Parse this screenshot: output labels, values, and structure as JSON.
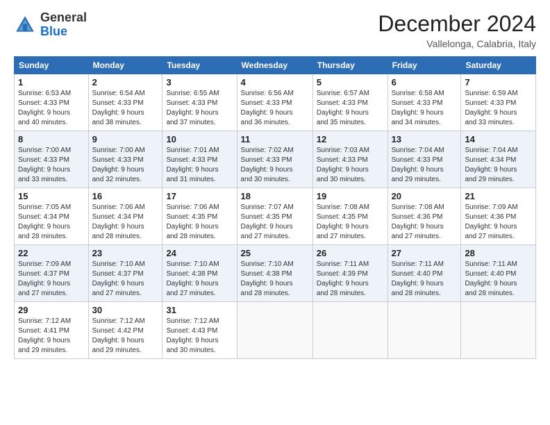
{
  "header": {
    "logo": {
      "general": "General",
      "blue": "Blue"
    },
    "month_title": "December 2024",
    "location": "Vallelonga, Calabria, Italy"
  },
  "calendar": {
    "weekdays": [
      "Sunday",
      "Monday",
      "Tuesday",
      "Wednesday",
      "Thursday",
      "Friday",
      "Saturday"
    ],
    "weeks": [
      [
        {
          "day": "1",
          "info": "Sunrise: 6:53 AM\nSunset: 4:33 PM\nDaylight: 9 hours\nand 40 minutes."
        },
        {
          "day": "2",
          "info": "Sunrise: 6:54 AM\nSunset: 4:33 PM\nDaylight: 9 hours\nand 38 minutes."
        },
        {
          "day": "3",
          "info": "Sunrise: 6:55 AM\nSunset: 4:33 PM\nDaylight: 9 hours\nand 37 minutes."
        },
        {
          "day": "4",
          "info": "Sunrise: 6:56 AM\nSunset: 4:33 PM\nDaylight: 9 hours\nand 36 minutes."
        },
        {
          "day": "5",
          "info": "Sunrise: 6:57 AM\nSunset: 4:33 PM\nDaylight: 9 hours\nand 35 minutes."
        },
        {
          "day": "6",
          "info": "Sunrise: 6:58 AM\nSunset: 4:33 PM\nDaylight: 9 hours\nand 34 minutes."
        },
        {
          "day": "7",
          "info": "Sunrise: 6:59 AM\nSunset: 4:33 PM\nDaylight: 9 hours\nand 33 minutes."
        }
      ],
      [
        {
          "day": "8",
          "info": "Sunrise: 7:00 AM\nSunset: 4:33 PM\nDaylight: 9 hours\nand 33 minutes."
        },
        {
          "day": "9",
          "info": "Sunrise: 7:00 AM\nSunset: 4:33 PM\nDaylight: 9 hours\nand 32 minutes."
        },
        {
          "day": "10",
          "info": "Sunrise: 7:01 AM\nSunset: 4:33 PM\nDaylight: 9 hours\nand 31 minutes."
        },
        {
          "day": "11",
          "info": "Sunrise: 7:02 AM\nSunset: 4:33 PM\nDaylight: 9 hours\nand 30 minutes."
        },
        {
          "day": "12",
          "info": "Sunrise: 7:03 AM\nSunset: 4:33 PM\nDaylight: 9 hours\nand 30 minutes."
        },
        {
          "day": "13",
          "info": "Sunrise: 7:04 AM\nSunset: 4:33 PM\nDaylight: 9 hours\nand 29 minutes."
        },
        {
          "day": "14",
          "info": "Sunrise: 7:04 AM\nSunset: 4:34 PM\nDaylight: 9 hours\nand 29 minutes."
        }
      ],
      [
        {
          "day": "15",
          "info": "Sunrise: 7:05 AM\nSunset: 4:34 PM\nDaylight: 9 hours\nand 28 minutes."
        },
        {
          "day": "16",
          "info": "Sunrise: 7:06 AM\nSunset: 4:34 PM\nDaylight: 9 hours\nand 28 minutes."
        },
        {
          "day": "17",
          "info": "Sunrise: 7:06 AM\nSunset: 4:35 PM\nDaylight: 9 hours\nand 28 minutes."
        },
        {
          "day": "18",
          "info": "Sunrise: 7:07 AM\nSunset: 4:35 PM\nDaylight: 9 hours\nand 27 minutes."
        },
        {
          "day": "19",
          "info": "Sunrise: 7:08 AM\nSunset: 4:35 PM\nDaylight: 9 hours\nand 27 minutes."
        },
        {
          "day": "20",
          "info": "Sunrise: 7:08 AM\nSunset: 4:36 PM\nDaylight: 9 hours\nand 27 minutes."
        },
        {
          "day": "21",
          "info": "Sunrise: 7:09 AM\nSunset: 4:36 PM\nDaylight: 9 hours\nand 27 minutes."
        }
      ],
      [
        {
          "day": "22",
          "info": "Sunrise: 7:09 AM\nSunset: 4:37 PM\nDaylight: 9 hours\nand 27 minutes."
        },
        {
          "day": "23",
          "info": "Sunrise: 7:10 AM\nSunset: 4:37 PM\nDaylight: 9 hours\nand 27 minutes."
        },
        {
          "day": "24",
          "info": "Sunrise: 7:10 AM\nSunset: 4:38 PM\nDaylight: 9 hours\nand 27 minutes."
        },
        {
          "day": "25",
          "info": "Sunrise: 7:10 AM\nSunset: 4:38 PM\nDaylight: 9 hours\nand 28 minutes."
        },
        {
          "day": "26",
          "info": "Sunrise: 7:11 AM\nSunset: 4:39 PM\nDaylight: 9 hours\nand 28 minutes."
        },
        {
          "day": "27",
          "info": "Sunrise: 7:11 AM\nSunset: 4:40 PM\nDaylight: 9 hours\nand 28 minutes."
        },
        {
          "day": "28",
          "info": "Sunrise: 7:11 AM\nSunset: 4:40 PM\nDaylight: 9 hours\nand 28 minutes."
        }
      ],
      [
        {
          "day": "29",
          "info": "Sunrise: 7:12 AM\nSunset: 4:41 PM\nDaylight: 9 hours\nand 29 minutes."
        },
        {
          "day": "30",
          "info": "Sunrise: 7:12 AM\nSunset: 4:42 PM\nDaylight: 9 hours\nand 29 minutes."
        },
        {
          "day": "31",
          "info": "Sunrise: 7:12 AM\nSunset: 4:43 PM\nDaylight: 9 hours\nand 30 minutes."
        },
        {
          "day": "",
          "info": ""
        },
        {
          "day": "",
          "info": ""
        },
        {
          "day": "",
          "info": ""
        },
        {
          "day": "",
          "info": ""
        }
      ]
    ]
  }
}
